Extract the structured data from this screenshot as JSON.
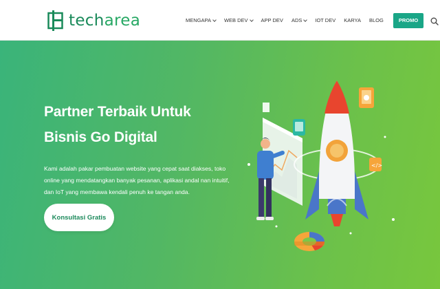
{
  "header": {
    "logo": {
      "text_dark": "tech",
      "text_light": "area",
      "icon": "techarea-logo-icon"
    },
    "nav": [
      {
        "label": "MENGAPA",
        "dropdown": true
      },
      {
        "label": "WEB DEV",
        "dropdown": true
      },
      {
        "label": "APP DEV",
        "dropdown": false
      },
      {
        "label": "ADS",
        "dropdown": true
      },
      {
        "label": "IOT DEV",
        "dropdown": false
      },
      {
        "label": "KARYA",
        "dropdown": false
      },
      {
        "label": "BLOG",
        "dropdown": false
      }
    ],
    "promo_label": "PROMO",
    "search_icon": "search-icon"
  },
  "hero": {
    "headline_line1": "Partner Terbaik Untuk",
    "headline_line2": "Bisnis Go Digital",
    "description": "Kami adalah pakar pembuatan website yang cepat saat diakses, toko online yang mendatangkan banyak pesanan, aplikasi andal nan intuitif, dan IoT yang membawa kendali penuh ke tangan anda.",
    "cta_label": "Konsultasi Gratis",
    "illustration": "rocket-launch-illustration"
  },
  "colors": {
    "brand": "#1a8a5a",
    "promo": "#1aa687",
    "hero_start": "#3ab47a",
    "hero_end": "#78c73d",
    "rocket_nose": "#e8452e",
    "rocket_fin": "#4a76c9"
  }
}
